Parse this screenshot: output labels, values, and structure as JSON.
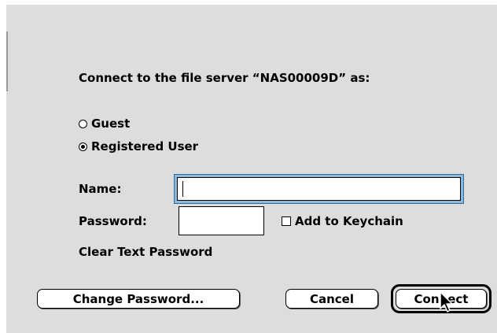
{
  "dialog": {
    "prompt": "Connect to the file server “NAS00009D” as:",
    "options": [
      {
        "label": "Guest",
        "selected": false
      },
      {
        "label": "Registered User",
        "selected": true
      }
    ],
    "name_label": "Name:",
    "name_value": "",
    "password_label": "Password:",
    "password_value": "",
    "keychain_label": "Add to Keychain",
    "keychain_checked": false,
    "clear_text_note": "Clear Text Password",
    "buttons": {
      "change_password": "Change Password...",
      "cancel": "Cancel",
      "connect": "Connect"
    },
    "icons": {
      "cursor": "arrow-cursor-icon"
    },
    "colors": {
      "background": "#dddddd",
      "focus_ring": "#8fb8d8"
    }
  }
}
